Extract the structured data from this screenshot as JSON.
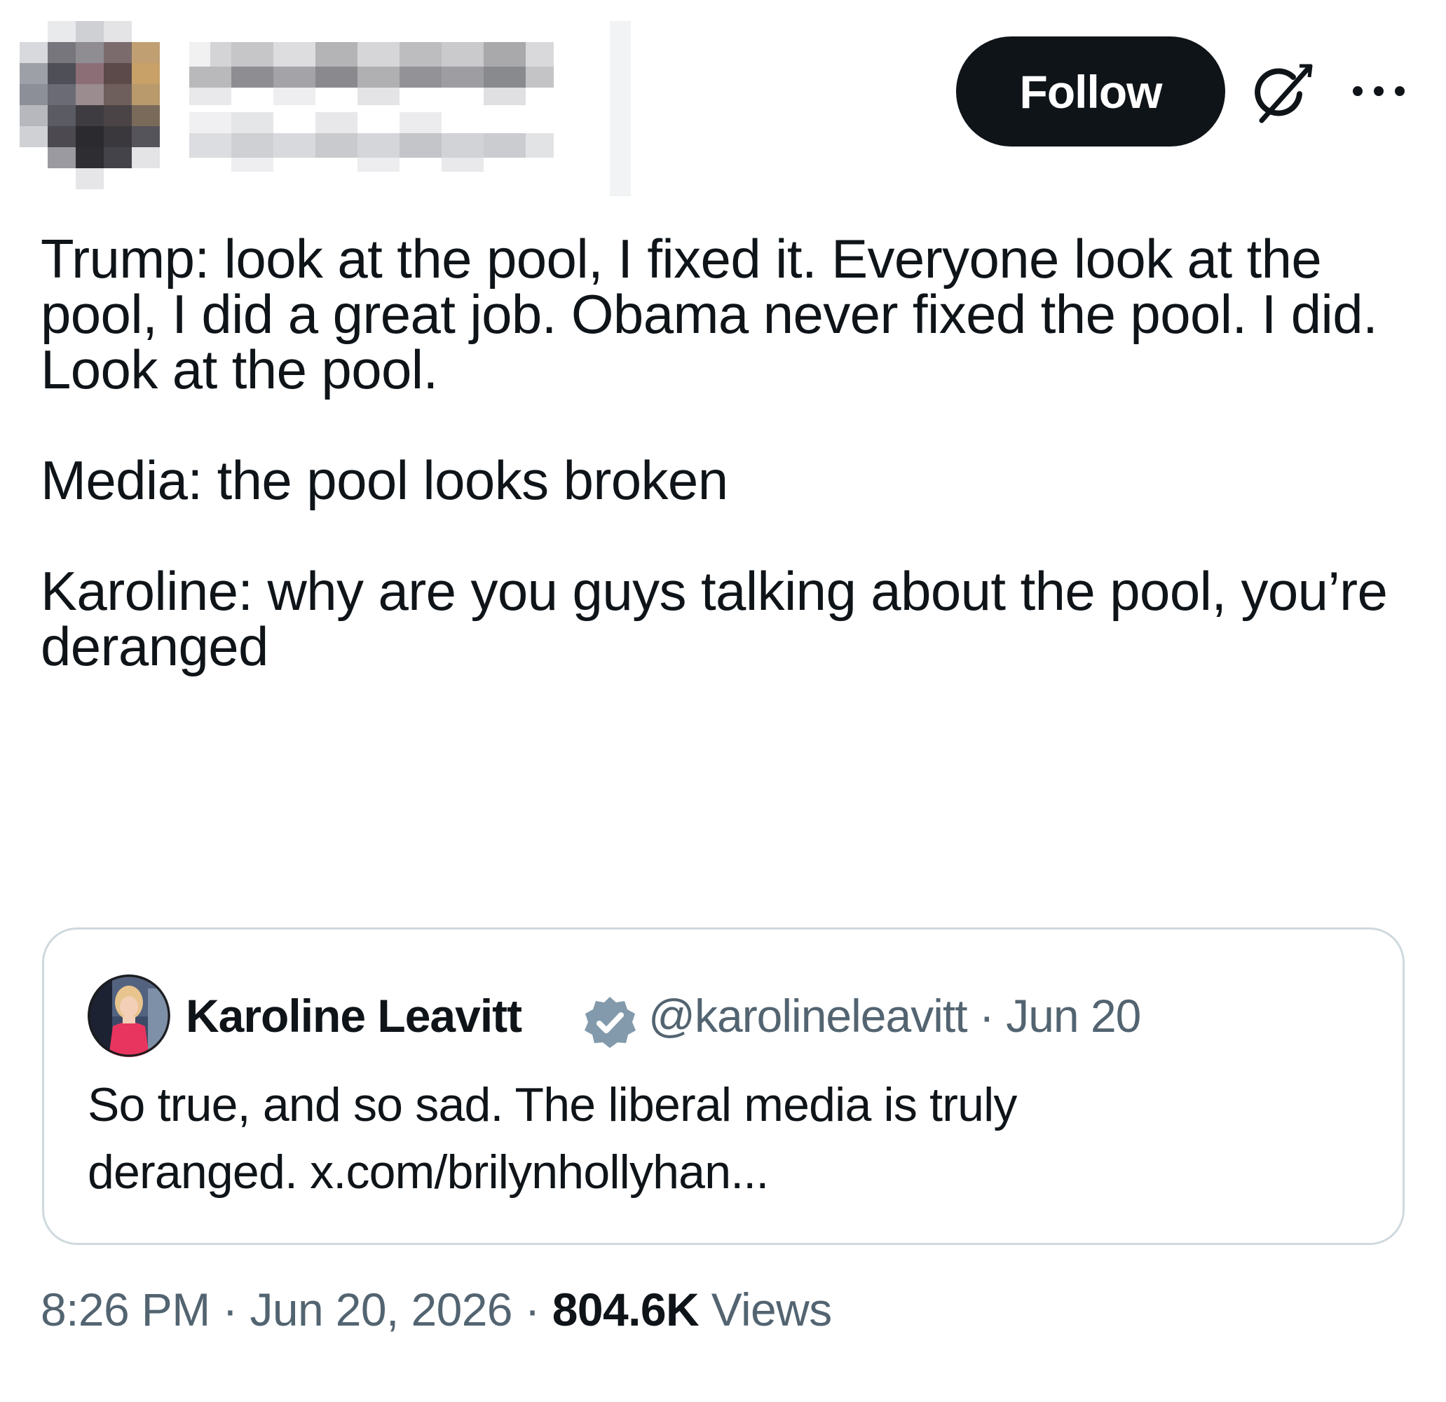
{
  "header": {
    "follow_label": "Follow",
    "grok_icon": "grok-icon",
    "more_icon": "more-icon",
    "avatar_note": "pixelated-avatar",
    "name_note": "pixelated-name"
  },
  "tweet": {
    "paragraphs": [
      "Trump: look at the pool, I fixed it. Everyone look at the pool, I did a great job. Obama never fixed the pool. I did. Look at the pool.",
      "Media: the pool looks broken",
      "Karoline: why are you guys talking about the pool, you’re deranged"
    ]
  },
  "quote": {
    "author_name": "Karoline Leavitt",
    "handle": "@karolineleavitt",
    "separator": " · ",
    "date": "Jun 20",
    "text_line1": "So true, and so sad. The liberal media is truly",
    "text_line2": "deranged. x.com/brilynhollyhan...",
    "verified_icon": "verified-badge-icon",
    "verified_color": "#829aab"
  },
  "footer": {
    "time": "8:26 PM",
    "separator": " · ",
    "date": "Jun 20, 2026",
    "views_count": "804.6K",
    "views_label": "Views"
  },
  "colors": {
    "text_primary": "#0f1419",
    "text_secondary": "#536471",
    "border": "#cfd9de",
    "button_bg": "#0f1419",
    "button_text": "#ffffff"
  }
}
